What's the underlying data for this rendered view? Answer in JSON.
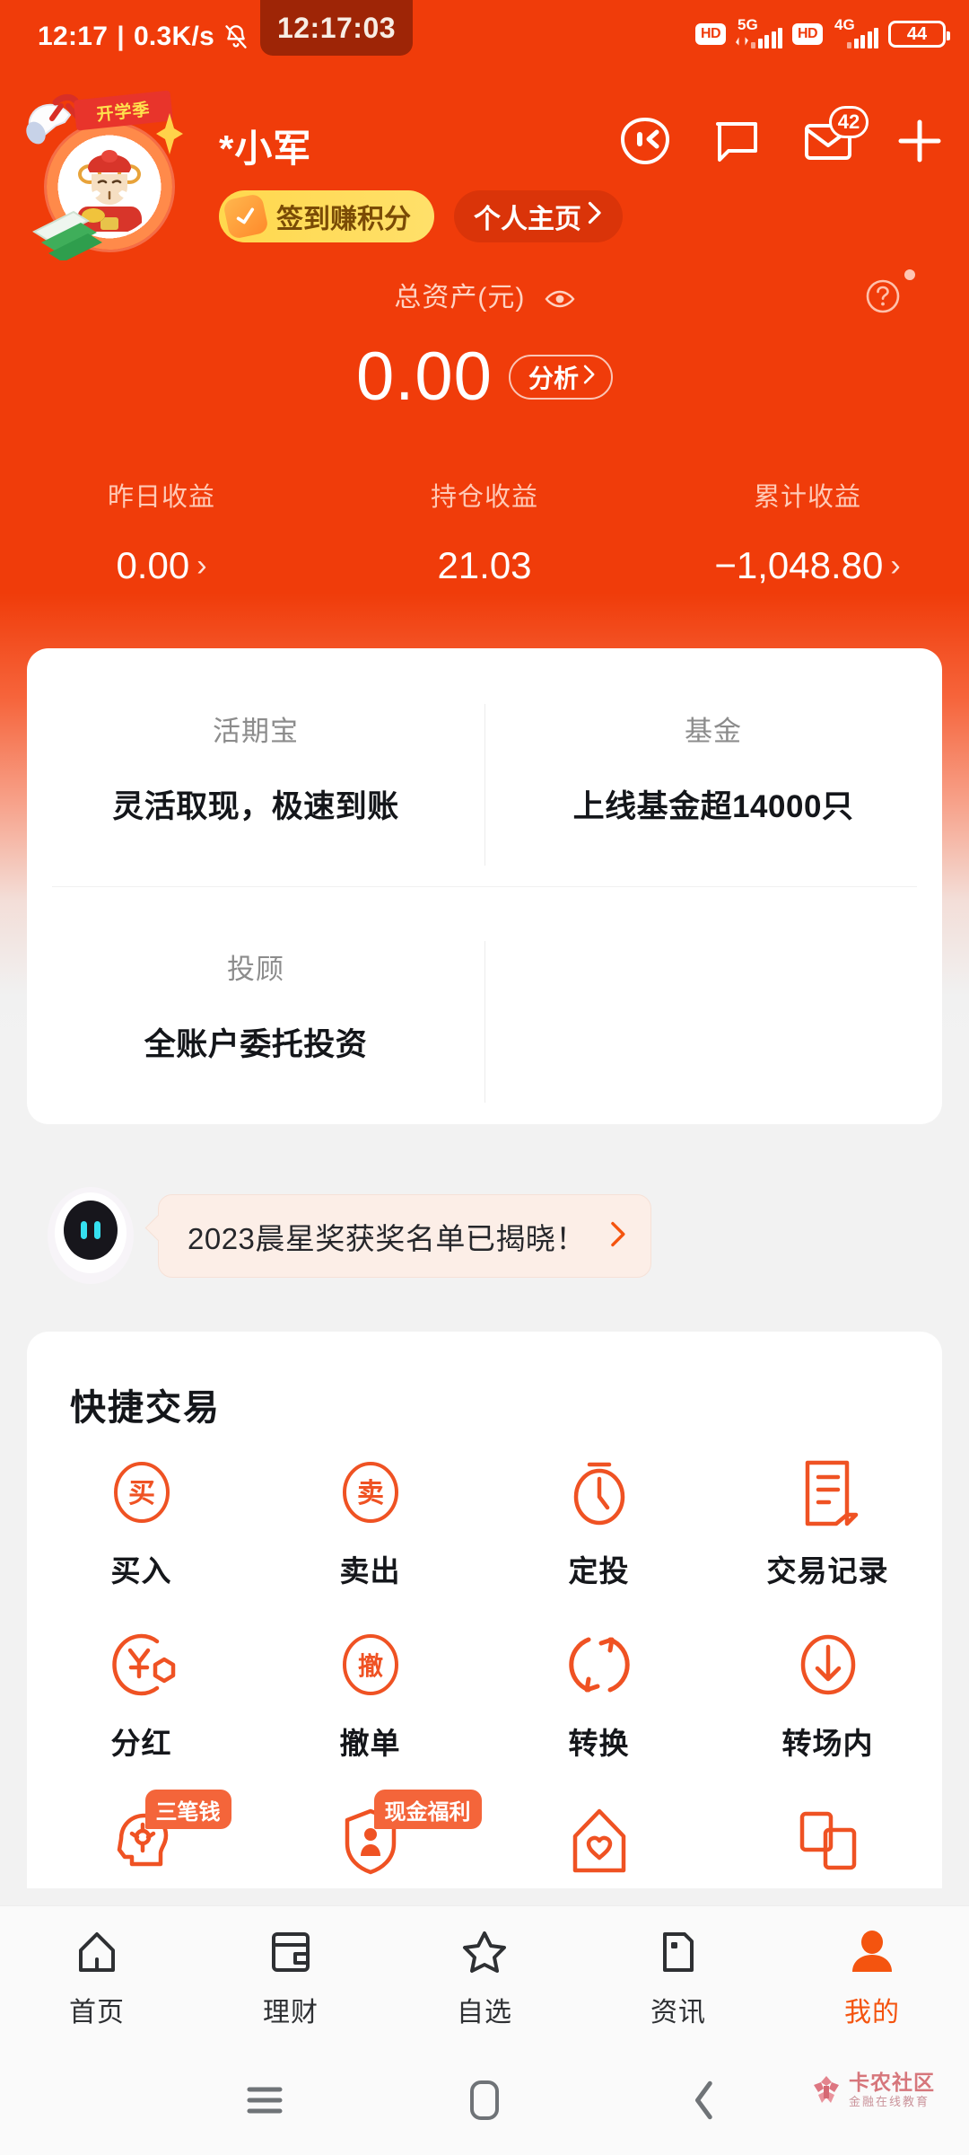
{
  "status_bar": {
    "time": "12:17",
    "separator": "|",
    "net_speed": "0.3K/s",
    "icons": [
      "bell-off-icon",
      "alarm-icon"
    ],
    "time_toast": "12:17:03",
    "right": {
      "hd1": "HD",
      "net1": "5G",
      "hd2": "HD",
      "net2": "4G",
      "battery": "44"
    }
  },
  "header": {
    "avatar_frame_label": "开学季",
    "username": "*小军",
    "icons": [
      {
        "name": "ai-assistant-icon"
      },
      {
        "name": "chat-bubble-icon"
      },
      {
        "name": "mail-icon",
        "badge": "42"
      },
      {
        "name": "plus-icon"
      }
    ],
    "signin_chip": "签到赚积分",
    "home_chip": "个人主页"
  },
  "assets": {
    "label": "总资产(元)",
    "eye_icon": "eye-icon",
    "help_icon": "question-circle-icon",
    "value": "0.00",
    "analysis_chip": "分析"
  },
  "earnings": [
    {
      "label": "昨日收益",
      "value": "0.00",
      "has_arrow": true
    },
    {
      "label": "持仓收益",
      "value": "21.03",
      "has_arrow": false
    },
    {
      "label": "累计收益",
      "value": "−1,048.80",
      "has_arrow": true
    }
  ],
  "products": [
    {
      "title": "活期宝",
      "subtitle": "灵活取现，极速到账"
    },
    {
      "title": "基金",
      "subtitle": "上线基金超14000只"
    },
    {
      "title": "投顾",
      "subtitle": "全账户委托投资"
    },
    {
      "title": "",
      "subtitle": ""
    }
  ],
  "announcement": {
    "robot_icon": "robot-assistant-icon",
    "text": "2023晨星奖获奖名单已揭晓！",
    "arrow_icon": "chevron-right-icon",
    "accent": "#f4540f"
  },
  "quick_trade": {
    "title": "快捷交易",
    "rows": [
      [
        {
          "label": "买入",
          "icon": "buy-circle-icon",
          "glyph": "买"
        },
        {
          "label": "卖出",
          "icon": "sell-circle-icon",
          "glyph": "卖"
        },
        {
          "label": "定投",
          "icon": "stopwatch-icon",
          "glyph": ""
        },
        {
          "label": "交易记录",
          "icon": "receipt-icon",
          "glyph": ""
        }
      ],
      [
        {
          "label": "分红",
          "icon": "dividend-yuan-icon",
          "glyph": ""
        },
        {
          "label": "撤单",
          "icon": "cancel-order-circle-icon",
          "glyph": "撤"
        },
        {
          "label": "转换",
          "icon": "convert-arrows-icon",
          "glyph": ""
        },
        {
          "label": "转场内",
          "icon": "transfer-in-icon",
          "glyph": ""
        }
      ],
      [
        {
          "label": "",
          "icon": "brain-head-icon",
          "glyph": "",
          "badge": "三笔钱"
        },
        {
          "label": "",
          "icon": "shield-person-icon",
          "glyph": "",
          "badge": "现金福利"
        },
        {
          "label": "",
          "icon": "house-heart-icon",
          "glyph": ""
        },
        {
          "label": "",
          "icon": "two-cards-icon",
          "glyph": ""
        }
      ]
    ]
  },
  "tab_bar": {
    "items": [
      {
        "label": "首页",
        "icon": "home-icon",
        "active": false
      },
      {
        "label": "理财",
        "icon": "wallet-icon",
        "active": false
      },
      {
        "label": "自选",
        "icon": "star-icon",
        "active": false
      },
      {
        "label": "资讯",
        "icon": "news-icon",
        "active": false
      },
      {
        "label": "我的",
        "icon": "person-icon",
        "active": true
      }
    ],
    "active_color": "#f4540f"
  },
  "nav_bar": {
    "recent_icon": "recents-icon",
    "home_icon": "home-square-icon",
    "back_icon": "back-chevron-icon"
  },
  "watermark": {
    "title": "卡农社区",
    "subtitle": "金融在线教育"
  },
  "theme": {
    "brand_red": "#f03c0a",
    "accent_orange": "#f4540f",
    "page_bg": "#f2f2f2"
  }
}
